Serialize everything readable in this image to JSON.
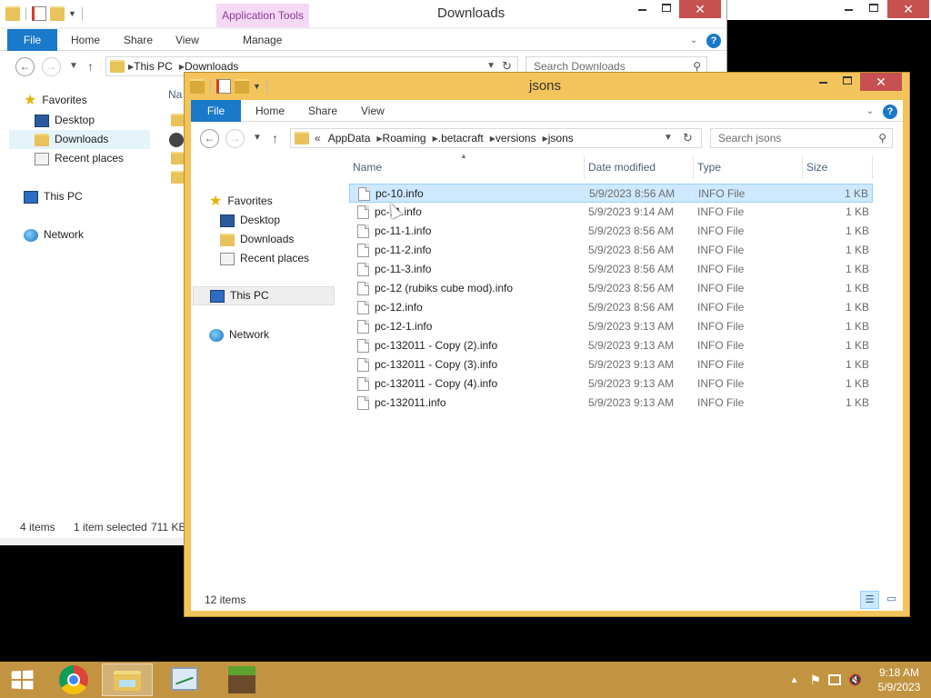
{
  "colors": {
    "accent": "#1979ca",
    "selection": "#cde8ff",
    "taskbar": "#c29441",
    "front_frame": "#f3c45b",
    "close_red": "#c75050",
    "app_tools": "#f5d9f4"
  },
  "back_window": {
    "title": "Downloads",
    "context_tab": "Application Tools",
    "tabs": {
      "file": "File",
      "home": "Home",
      "share": "Share",
      "view": "View",
      "manage": "Manage"
    },
    "address": [
      "This PC",
      "Downloads"
    ],
    "search_placeholder": "Search Downloads",
    "nav": {
      "favorites": "Favorites",
      "desktop": "Desktop",
      "downloads": "Downloads",
      "recent": "Recent places",
      "this_pc": "This PC",
      "network": "Network"
    },
    "column_partial": "Na",
    "status": {
      "count": "4 items",
      "selected": "1 item selected",
      "size": "711 KB"
    }
  },
  "front_window": {
    "title": "jsons",
    "tabs": {
      "file": "File",
      "home": "Home",
      "share": "Share",
      "view": "View"
    },
    "address": {
      "overflow": "«",
      "crumbs": [
        "AppData",
        "Roaming",
        ".betacraft",
        "versions",
        "jsons"
      ]
    },
    "search_placeholder": "Search jsons",
    "nav": {
      "favorites": "Favorites",
      "desktop": "Desktop",
      "downloads": "Downloads",
      "recent": "Recent places",
      "this_pc": "This PC",
      "network": "Network"
    },
    "columns": {
      "name": "Name",
      "date": "Date modified",
      "type": "Type",
      "size": "Size"
    },
    "files": [
      {
        "name": "pc-10.info",
        "date": "5/9/2023 8:56 AM",
        "type": "INFO File",
        "size": "1 KB",
        "selected": true
      },
      {
        "name": "pc-11.info",
        "date": "5/9/2023 9:14 AM",
        "type": "INFO File",
        "size": "1 KB"
      },
      {
        "name": "pc-11-1.info",
        "date": "5/9/2023 8:56 AM",
        "type": "INFO File",
        "size": "1 KB"
      },
      {
        "name": "pc-11-2.info",
        "date": "5/9/2023 8:56 AM",
        "type": "INFO File",
        "size": "1 KB"
      },
      {
        "name": "pc-11-3.info",
        "date": "5/9/2023 8:56 AM",
        "type": "INFO File",
        "size": "1 KB"
      },
      {
        "name": "pc-12 (rubiks cube mod).info",
        "date": "5/9/2023 8:56 AM",
        "type": "INFO File",
        "size": "1 KB"
      },
      {
        "name": "pc-12.info",
        "date": "5/9/2023 8:56 AM",
        "type": "INFO File",
        "size": "1 KB"
      },
      {
        "name": "pc-12-1.info",
        "date": "5/9/2023 9:13 AM",
        "type": "INFO File",
        "size": "1 KB"
      },
      {
        "name": "pc-132011 - Copy (2).info",
        "date": "5/9/2023 9:13 AM",
        "type": "INFO File",
        "size": "1 KB"
      },
      {
        "name": "pc-132011 - Copy (3).info",
        "date": "5/9/2023 9:13 AM",
        "type": "INFO File",
        "size": "1 KB"
      },
      {
        "name": "pc-132011 - Copy (4).info",
        "date": "5/9/2023 9:13 AM",
        "type": "INFO File",
        "size": "1 KB"
      },
      {
        "name": "pc-132011.info",
        "date": "5/9/2023 9:13 AM",
        "type": "INFO File",
        "size": "1 KB"
      }
    ],
    "status": {
      "count": "12 items"
    }
  },
  "taskbar": {
    "apps": [
      "chrome-icon",
      "file-explorer-icon",
      "performance-monitor-icon",
      "minecraft-icon"
    ],
    "clock": {
      "time": "9:18 AM",
      "date": "5/9/2023"
    }
  }
}
